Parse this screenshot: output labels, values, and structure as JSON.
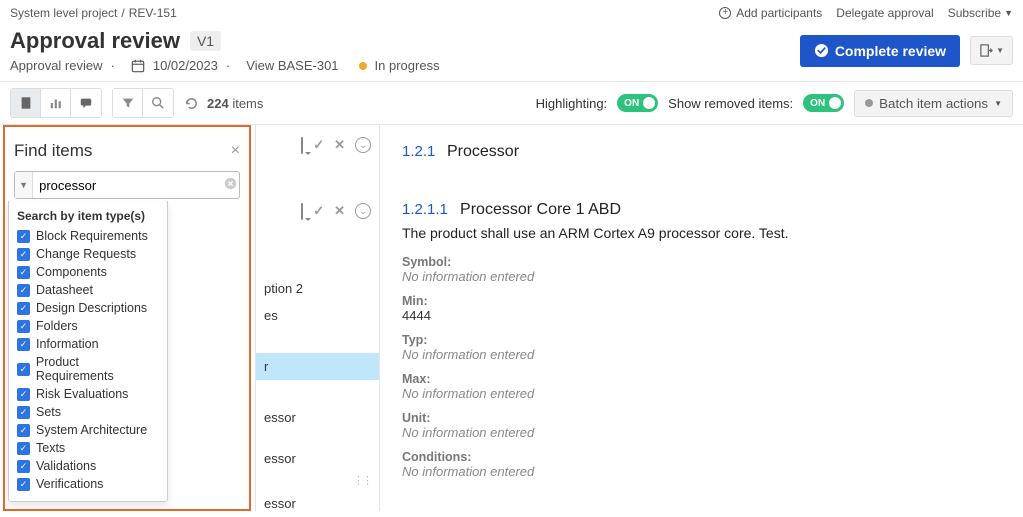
{
  "breadcrumb": {
    "project": "System level project",
    "item": "REV-151"
  },
  "top_actions": {
    "add_participants": "Add participants",
    "delegate": "Delegate approval",
    "subscribe": "Subscribe"
  },
  "title": {
    "heading": "Approval review",
    "version": "V1",
    "subtitle": "Approval review",
    "date": "10/02/2023",
    "view": "View BASE-301",
    "status": "In progress"
  },
  "primary_button": "Complete review",
  "toolbar": {
    "count_num": "224",
    "count_label": "items",
    "highlight": "Highlighting:",
    "highlight_state": "ON",
    "removed": "Show removed items:",
    "removed_state": "ON",
    "batch": "Batch item actions"
  },
  "find": {
    "title": "Find items",
    "value": "processor",
    "dd_title": "Search by item type(s)",
    "types": [
      "Block Requirements",
      "Change Requests",
      "Components",
      "Datasheet",
      "Design Descriptions",
      "Folders",
      "Information",
      "Product Requirements",
      "Risk Evaluations",
      "Sets",
      "System Architecture",
      "Texts",
      "Validations",
      "Verifications"
    ]
  },
  "mid": {
    "frag1": "ption 2",
    "frag2": "es",
    "sel": "r",
    "frag3": "essor",
    "frag4": "essor",
    "frag5": "essor"
  },
  "detail": {
    "sec_num": "1.2.1",
    "sec_title": "Processor",
    "sub_num": "1.2.1.1",
    "sub_title": "Processor Core 1 ABD",
    "body": "The product shall use an ARM Cortex A9 processor core. Test.",
    "fields": [
      {
        "label": "Symbol:",
        "value": "",
        "empty": "No information entered"
      },
      {
        "label": "Min:",
        "value": "4444",
        "empty": ""
      },
      {
        "label": "Typ:",
        "value": "",
        "empty": "No information entered"
      },
      {
        "label": "Max:",
        "value": "",
        "empty": "No information entered"
      },
      {
        "label": "Unit:",
        "value": "",
        "empty": "No information entered"
      },
      {
        "label": "Conditions:",
        "value": "",
        "empty": "No information entered"
      }
    ]
  }
}
